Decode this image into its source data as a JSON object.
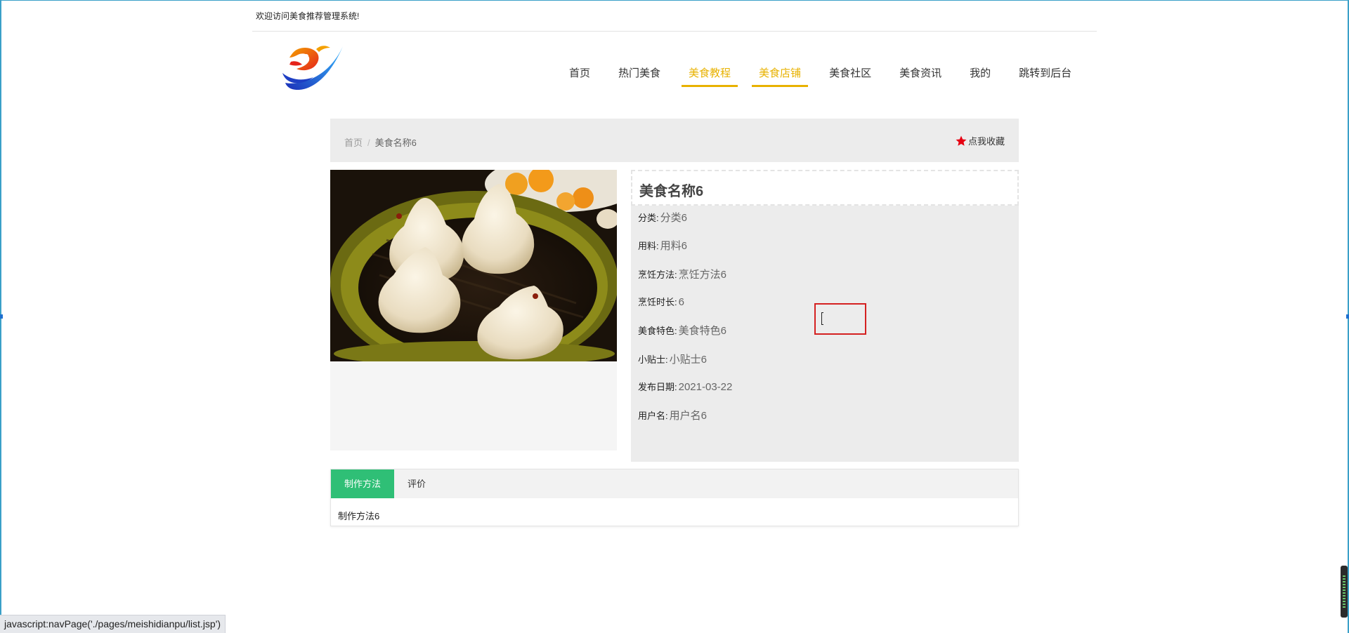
{
  "header": {
    "welcome_text": "欢迎访问美食推荐管理系统!"
  },
  "nav": {
    "items": [
      {
        "label": "首页",
        "active": false
      },
      {
        "label": "热门美食",
        "active": false
      },
      {
        "label": "美食教程",
        "active": true
      },
      {
        "label": "美食店铺",
        "active": true
      },
      {
        "label": "美食社区",
        "active": false
      },
      {
        "label": "美食资讯",
        "active": false
      },
      {
        "label": "我的",
        "active": false
      },
      {
        "label": "跳转到后台",
        "active": false
      }
    ],
    "accent_color": "#e8b200"
  },
  "breadcrumb": {
    "home": "首页",
    "separator": "/",
    "current": "美食名称6"
  },
  "favorite": {
    "label": "点我收藏",
    "icon": "star-icon",
    "icon_color": "#e60012"
  },
  "detail": {
    "title": "美食名称6",
    "fields": [
      {
        "label": "分类:",
        "value": "分类6"
      },
      {
        "label": "用料:",
        "value": "用料6"
      },
      {
        "label": "烹饪方法:",
        "value": "烹饪方法6"
      },
      {
        "label": "烹饪时长:",
        "value": "6"
      },
      {
        "label": "美食特色:",
        "value": "美食特色6"
      },
      {
        "label": "小贴士:",
        "value": "小贴士6"
      },
      {
        "label": "发布日期:",
        "value": "2021-03-22"
      },
      {
        "label": "用户名:",
        "value": "用户名6"
      }
    ]
  },
  "tabs": {
    "items": [
      {
        "label": "制作方法",
        "active": true
      },
      {
        "label": "评价",
        "active": false
      }
    ],
    "active_color": "#2fbf76",
    "content": "制作方法6"
  },
  "status_bar": {
    "text": "javascript:navPage('./pages/meishidianpu/list.jsp')"
  }
}
